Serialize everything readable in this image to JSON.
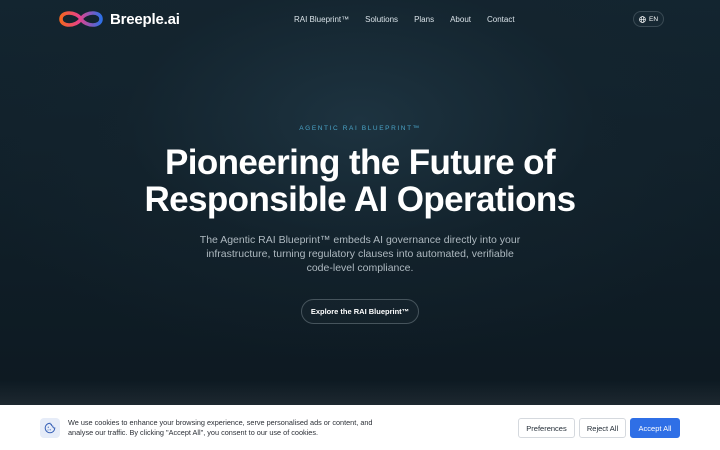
{
  "header": {
    "logo_text": "Breeple.ai",
    "nav": [
      {
        "label": "RAI Blueprint™"
      },
      {
        "label": "Solutions"
      },
      {
        "label": "Plans"
      },
      {
        "label": "About"
      },
      {
        "label": "Contact"
      }
    ],
    "language": "EN",
    "language_icon": "globe-icon"
  },
  "hero": {
    "eyebrow": "AGENTIC RAI BLUEPRINT™",
    "headline_line1": "Pioneering the Future of",
    "headline_line2": "Responsible AI Operations",
    "subtext": "The Agentic RAI Blueprint™ embeds AI governance directly into your infrastructure, turning regulatory clauses into automated, verifiable code-level compliance.",
    "cta_label": "Explore the RAI Blueprint™"
  },
  "cookie_banner": {
    "icon": "cookie-icon",
    "text": "We use cookies to enhance your browsing experience, serve personalised ads or content, and analyse our traffic. By clicking \"Accept All\", you consent to our use of cookies.",
    "preferences_label": "Preferences",
    "reject_label": "Reject All",
    "accept_label": "Accept All"
  },
  "colors": {
    "background": "#0f1c24",
    "accent": "#2f6fe6",
    "eyebrow": "#4aa3c7",
    "logo_gradient_start": "#f26522",
    "logo_gradient_end": "#2f6fe6"
  }
}
